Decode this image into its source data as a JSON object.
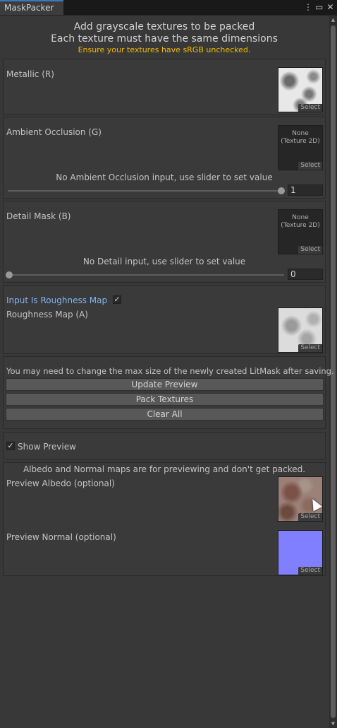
{
  "window": {
    "tab_title": "MaskPacker",
    "icons": [
      "kebab-menu-icon",
      "maximize-icon",
      "close-icon"
    ]
  },
  "header": {
    "line1": "Add grayscale textures to be packed",
    "line2": "Each texture must have the same dimensions",
    "warning": "Ensure your textures have sRGB unchecked.",
    "warning_color": "#f4bc02"
  },
  "metallic": {
    "label": "Metallic (R)",
    "select_label": "Select"
  },
  "ao": {
    "label": "Ambient Occlusion (G)",
    "none_line1": "None",
    "none_line2": "(Texture 2D)",
    "select_label": "Select",
    "message": "No Ambient Occlusion input, use slider to set value",
    "slider_value": "1",
    "slider_fraction": 1.0
  },
  "detail": {
    "label": "Detail Mask (B)",
    "none_line1": "None",
    "none_line2": "(Texture 2D)",
    "select_label": "Select",
    "message": "No Detail input, use slider to set value",
    "slider_value": "0",
    "slider_fraction": 0.0
  },
  "roughness": {
    "toggle_label": "Input Is Roughness Map",
    "toggle_checked": true,
    "map_label": "Roughness Map (A)",
    "select_label": "Select"
  },
  "actions": {
    "note": "You may need to change the max size of the newly created LitMask after saving.",
    "update_preview": "Update Preview",
    "pack_textures": "Pack Textures",
    "clear_all": "Clear All"
  },
  "show_preview": {
    "label": "Show Preview",
    "checked": true
  },
  "preview": {
    "note": "Albedo and Normal maps are for previewing and don't get packed.",
    "albedo_label": "Preview Albedo (optional)",
    "normal_label": "Preview Normal (optional)",
    "select_label": "Select",
    "normal_color": "#7f7fff"
  },
  "colors": {
    "accent": "#3a79bb",
    "toggle_label": "#7fb4f5"
  }
}
